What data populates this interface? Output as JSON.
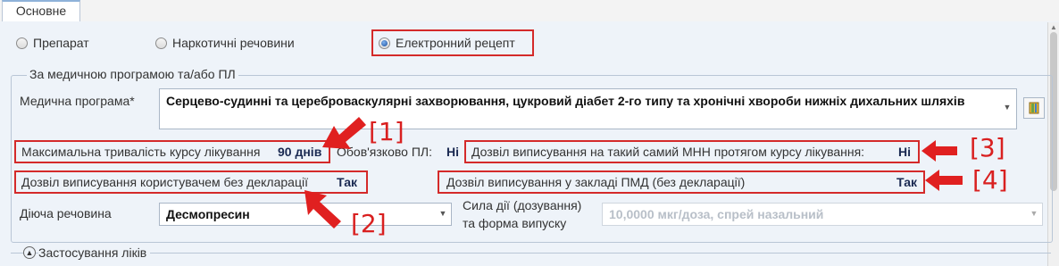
{
  "tabs": [
    {
      "label": "Основне"
    }
  ],
  "radios": {
    "preparation": "Препарат",
    "narcotic": "Наркотичні речовини",
    "e_prescription": "Електронний рецепт",
    "selected": "e_prescription"
  },
  "group": {
    "legend": "За медичною програмою та/або ПЛ",
    "program_label": "Медична програма*",
    "program_value": "Серцево-судинні та цереброваскулярні захворювання, цукровий діабет 2-го типу та хронічні хвороби нижніх дихальних шляхів",
    "max_course_label": "Максимальна тривалість курсу лікування",
    "max_course_value": "90 днів",
    "mandatory_pl_label": "Обов'язково ПЛ:",
    "mandatory_pl_value": "Ні",
    "same_mnn_label": "Дозвіл виписування на такий самий МНН протягом курсу лікування:",
    "same_mnn_value": "Ні",
    "user_no_decl_label": "Дозвіл виписування користувачем без декларації",
    "user_no_decl_value": "Так",
    "pmd_label": "Дозвіл виписування у закладі ПМД (без декларації)",
    "pmd_value": "Так",
    "active_substance_label": "Діюча речовина",
    "active_substance_value": "Десмопресин",
    "strength_label_1": "Сила дії (дозування)",
    "strength_label_2": "та форма випуску",
    "strength_placeholder": "10,0000 мкг/доза, спрей назальний"
  },
  "annotations": {
    "m1": "[1]",
    "m2": "[2]",
    "m3": "[3]",
    "m4": "[4]",
    "color": "#d42a2a"
  },
  "section": {
    "drug_use_label": "Застосування ліків"
  },
  "icons": {
    "program_lookup": "book-icon",
    "expander": "chevron-up-icon"
  }
}
